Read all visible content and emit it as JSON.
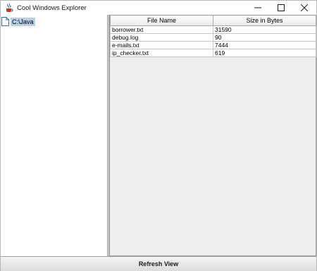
{
  "window": {
    "title": "Cool Windows Explorer",
    "icon": "java-cup-icon"
  },
  "title_buttons": {
    "minimize": "minimize-icon",
    "maximize": "maximize-icon",
    "close": "close-icon"
  },
  "tree": {
    "root_label": "C:\\Java",
    "root_icon": "file-icon"
  },
  "table": {
    "columns": [
      "File Name",
      "Size in Bytes"
    ],
    "rows": [
      {
        "name": "borrower.txt",
        "size": "31590"
      },
      {
        "name": "debug.log",
        "size": "90"
      },
      {
        "name": "e-mails.txt",
        "size": "7444"
      },
      {
        "name": "ip_checker.txt",
        "size": "619"
      }
    ]
  },
  "footer": {
    "refresh_label": "Refresh View"
  },
  "colors": {
    "selection": "#b8cfe5",
    "pane_background": "#eeeeee"
  }
}
